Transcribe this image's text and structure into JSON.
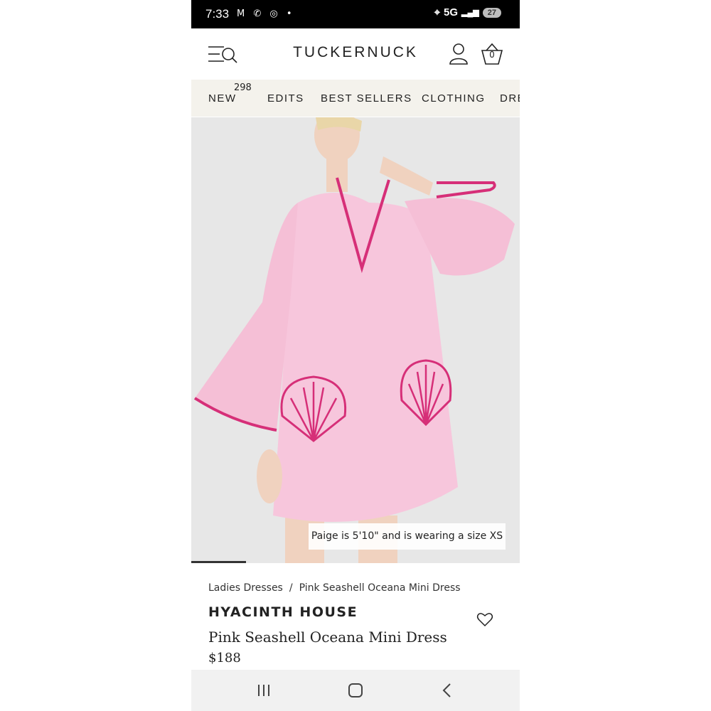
{
  "status_bar": {
    "time": "7:33",
    "notification_icons": "M ✆ ◎ •",
    "network": "5G",
    "battery": "27"
  },
  "header": {
    "brand": "TUCKERNUCK",
    "basket_count": "0"
  },
  "nav": {
    "items": [
      {
        "label": "NEW",
        "badge": "298"
      },
      {
        "label": "EDITS"
      },
      {
        "label": "BEST SELLERS"
      },
      {
        "label": "CLOTHING"
      },
      {
        "label": "DRE"
      }
    ]
  },
  "hero": {
    "caption": "Paige is 5'10\" and is wearing a size XS",
    "image_colors": {
      "dress": "#f7c6dc",
      "trim": "#d62f78",
      "background": "#e7e7e7",
      "skin": "#f0d2bf"
    }
  },
  "product": {
    "breadcrumb": [
      "Ladies Dresses",
      "Pink Seashell Oceana Mini Dress"
    ],
    "breadcrumb_separator": "/",
    "brand": "HYACINTH HOUSE",
    "title": "Pink Seashell Oceana Mini Dress",
    "price": "$188"
  },
  "icons": [
    "menu-search-icon",
    "account-icon",
    "basket-icon",
    "heart-icon",
    "recents-icon",
    "home-icon",
    "back-icon"
  ]
}
